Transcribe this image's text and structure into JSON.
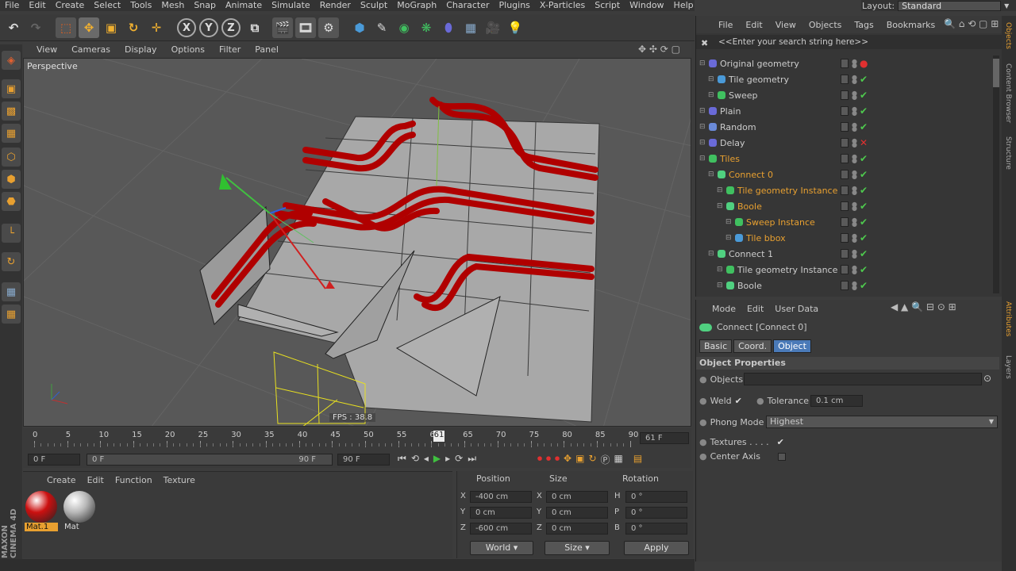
{
  "menu": [
    "File",
    "Edit",
    "Create",
    "Select",
    "Tools",
    "Mesh",
    "Snap",
    "Animate",
    "Simulate",
    "Render",
    "Sculpt",
    "MoGraph",
    "Character",
    "Plugins",
    "X-Particles",
    "Script",
    "Window",
    "Help"
  ],
  "layout": {
    "label": "Layout:",
    "value": "Standard"
  },
  "viewport": {
    "menu": [
      "View",
      "Cameras",
      "Display",
      "Options",
      "Filter",
      "Panel"
    ],
    "name": "Perspective",
    "fps": "FPS : 38.8"
  },
  "timeline": {
    "ticks": [
      "0",
      "5",
      "10",
      "15",
      "20",
      "25",
      "30",
      "35",
      "40",
      "45",
      "50",
      "55",
      "60",
      "65",
      "70",
      "75",
      "80",
      "85",
      "90"
    ],
    "current": "61",
    "frame_field": "61 F",
    "start": "0 F",
    "range_start": "0 F",
    "range_end": "90 F",
    "end": "90 F"
  },
  "materials": {
    "menu": [
      "Create",
      "Edit",
      "Function",
      "Texture"
    ],
    "items": [
      {
        "name": "Mat.1",
        "color": "#cc1010"
      },
      {
        "name": "Mat",
        "color": "#b8b8b8"
      }
    ]
  },
  "coords": {
    "headers": [
      "Position",
      "Size",
      "Rotation"
    ],
    "rows": [
      {
        "a": "X",
        "pos": "-400 cm",
        "b": "X",
        "size": "0 cm",
        "c": "H",
        "rot": "0 °"
      },
      {
        "a": "Y",
        "pos": "0 cm",
        "b": "Y",
        "size": "0 cm",
        "c": "P",
        "rot": "0 °"
      },
      {
        "a": "Z",
        "pos": "-600 cm",
        "b": "Z",
        "size": "0 cm",
        "c": "B",
        "rot": "0 °"
      }
    ],
    "mode": "World",
    "size_mode": "Size",
    "apply": "Apply"
  },
  "objects": {
    "menu": [
      "File",
      "Edit",
      "View",
      "Objects",
      "Tags",
      "Bookmarks"
    ],
    "search_placeholder": "<<Enter your search string here>>",
    "rows": [
      {
        "label": "Original geometry",
        "indent": 0,
        "color": "#cccccc",
        "icon": "L0",
        "status": "dot"
      },
      {
        "label": "Tile geometry",
        "indent": 1,
        "color": "#cccccc",
        "icon": "cube",
        "status": "check"
      },
      {
        "label": "Sweep",
        "indent": 1,
        "color": "#cccccc",
        "icon": "sweep",
        "status": "check"
      },
      {
        "label": "Plain",
        "indent": 0,
        "color": "#cccccc",
        "icon": "plain",
        "status": "check"
      },
      {
        "label": "Random",
        "indent": 0,
        "color": "#cccccc",
        "icon": "random",
        "status": "check"
      },
      {
        "label": "Delay",
        "indent": 0,
        "color": "#cccccc",
        "icon": "delay",
        "status": "cross"
      },
      {
        "label": "Tiles",
        "indent": 0,
        "color": "#e8a030",
        "icon": "tiles",
        "status": "check"
      },
      {
        "label": "Connect 0",
        "indent": 1,
        "color": "#e8a030",
        "icon": "connect",
        "status": "check"
      },
      {
        "label": "Tile geometry Instance",
        "indent": 2,
        "color": "#e8a030",
        "icon": "instance",
        "status": "check"
      },
      {
        "label": "Boole",
        "indent": 2,
        "color": "#e8a030",
        "icon": "boole",
        "status": "check"
      },
      {
        "label": "Sweep Instance",
        "indent": 3,
        "color": "#e8a030",
        "icon": "instance",
        "status": "check"
      },
      {
        "label": "Tile bbox",
        "indent": 3,
        "color": "#e8a030",
        "icon": "cube",
        "status": "check"
      },
      {
        "label": "Connect 1",
        "indent": 1,
        "color": "#cccccc",
        "icon": "connect",
        "status": "check"
      },
      {
        "label": "Tile geometry Instance",
        "indent": 2,
        "color": "#cccccc",
        "icon": "instance",
        "status": "check"
      },
      {
        "label": "Boole",
        "indent": 2,
        "color": "#cccccc",
        "icon": "boole",
        "status": "check"
      }
    ]
  },
  "attributes": {
    "menu": [
      "Mode",
      "Edit",
      "User Data"
    ],
    "title": "Connect [Connect 0]",
    "tabs": [
      "Basic",
      "Coord.",
      "Object"
    ],
    "active_tab": "Object",
    "section": "Object Properties",
    "objects_label": "Objects",
    "weld_label": "Weld",
    "tolerance_label": "Tolerance",
    "tolerance": "0.1 cm",
    "phong_label": "Phong Mode",
    "phong_value": "Highest",
    "textures_label": "Textures . . . .",
    "center_label": "Center Axis"
  },
  "side_tabs": [
    "Objects",
    "Content Browser",
    "Structure",
    "Attributes",
    "Layers"
  ],
  "brand": "MAXON CINEMA 4D"
}
